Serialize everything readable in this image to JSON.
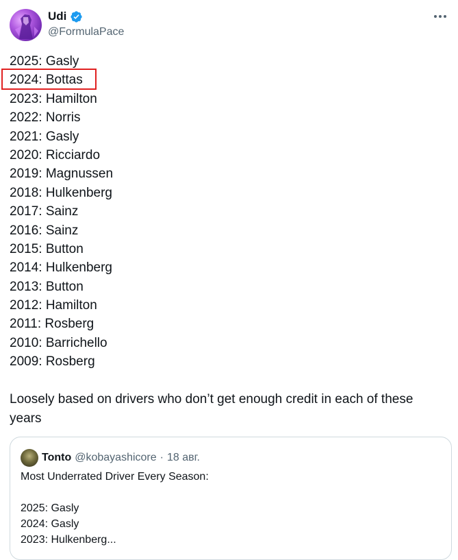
{
  "author": {
    "name": "Udi",
    "handle": "@FormulaPace",
    "verified": true
  },
  "tweet": {
    "lines": [
      "2025: Gasly",
      "2024: Bottas",
      "2023: Hamilton",
      "2022: Norris",
      "2021: Gasly",
      "2020: Ricciardo",
      "2019: Magnussen",
      "2018: Hulkenberg",
      "2017: Sainz",
      "2016: Sainz",
      "2015: Button",
      "2014: Hulkenberg",
      "2013: Button",
      "2012: Hamilton",
      "2011: Rosberg",
      "2010: Barrichello",
      "2009: Rosberg"
    ],
    "highlighted_line": "2024: Bottas",
    "tail": "Loosely based on drivers who don’t get enough credit in each of these years"
  },
  "quote": {
    "name": "Tonto",
    "handle": "@kobayashicore",
    "separator": "·",
    "date": "18 авг.",
    "lines": [
      "Most Underrated Driver Every Season:",
      "",
      "2025: Gasly",
      "2024: Gasly",
      "2023: Hulkenberg..."
    ]
  },
  "colors": {
    "verified_badge": "#1d9bf0",
    "highlight_box": "#e02020",
    "secondary_text": "#536471"
  },
  "icons": {
    "more": "more-horizontal-icon",
    "verified": "verified-badge-icon"
  }
}
